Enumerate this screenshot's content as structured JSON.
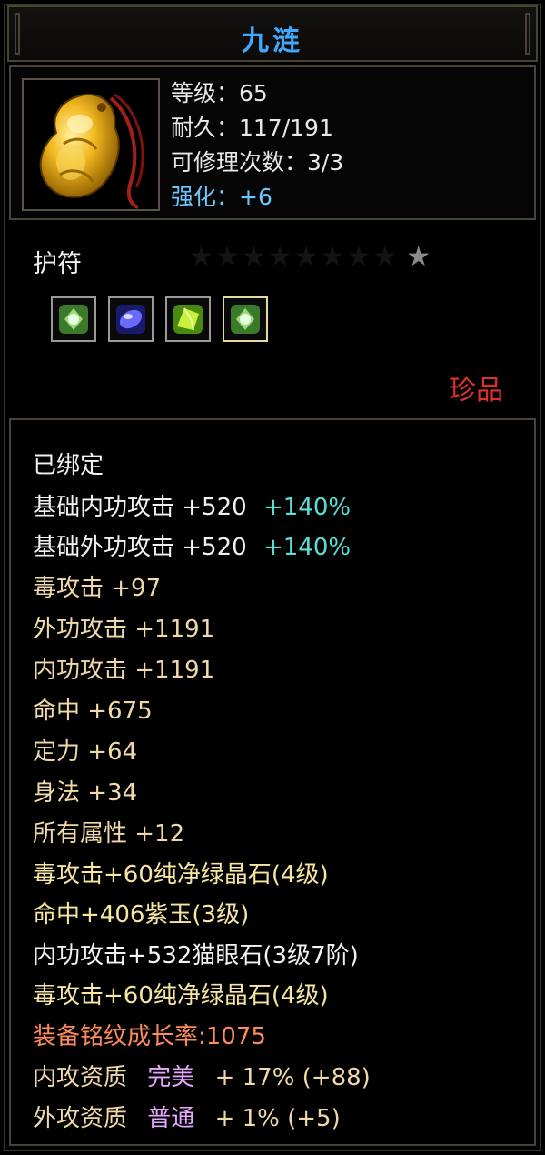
{
  "item": {
    "name": "九涟",
    "stats": {
      "level": "等级：65",
      "durability": "耐久：117/191",
      "repairs": "可修理次数：3/3",
      "enhance": "强化：+6"
    },
    "type": "护符",
    "stars_total": 9,
    "rarity": "珍品",
    "gems": [
      "green-crystal-icon",
      "purple-jade-icon",
      "green-crystal-icon",
      "green-crystal-icon"
    ]
  },
  "attributes": {
    "bound": "已绑定",
    "base_inner": {
      "text": "基础内功攻击 +520",
      "bonus": "+140%"
    },
    "base_outer": {
      "text": "基础外功攻击 +520",
      "bonus": "+140%"
    },
    "poison": "毒攻击 +97",
    "outer_attack": "外功攻击 +1191",
    "inner_attack": "内功攻击 +1191",
    "hit": "命中 +675",
    "focus": "定力 +64",
    "agility": "身法 +34",
    "all_attr": "所有属性 +12",
    "gem1": "毒攻击+60纯净绿晶石(4级)",
    "gem2": "命中+406紫玉(3级)",
    "gem3": "内功攻击+532猫眼石(3级7阶)",
    "gem4": "毒攻击+60纯净绿晶石(4级)",
    "growth": "装备铭纹成长率:1075",
    "inner_quality": {
      "label": "内攻资质",
      "grade": "完美",
      "value": "+ 17% (+88)"
    },
    "outer_quality": {
      "label": "外攻资质",
      "grade": "普通",
      "value": "+ 1% (+5)"
    }
  },
  "colors": {
    "title": "#3fa9ff",
    "enhance": "#6ec6ff",
    "rarity": "#e0302a",
    "growth": "#ff8a5a",
    "bonus": "#57e0d6",
    "quality_grade": "#e7a8ff"
  }
}
